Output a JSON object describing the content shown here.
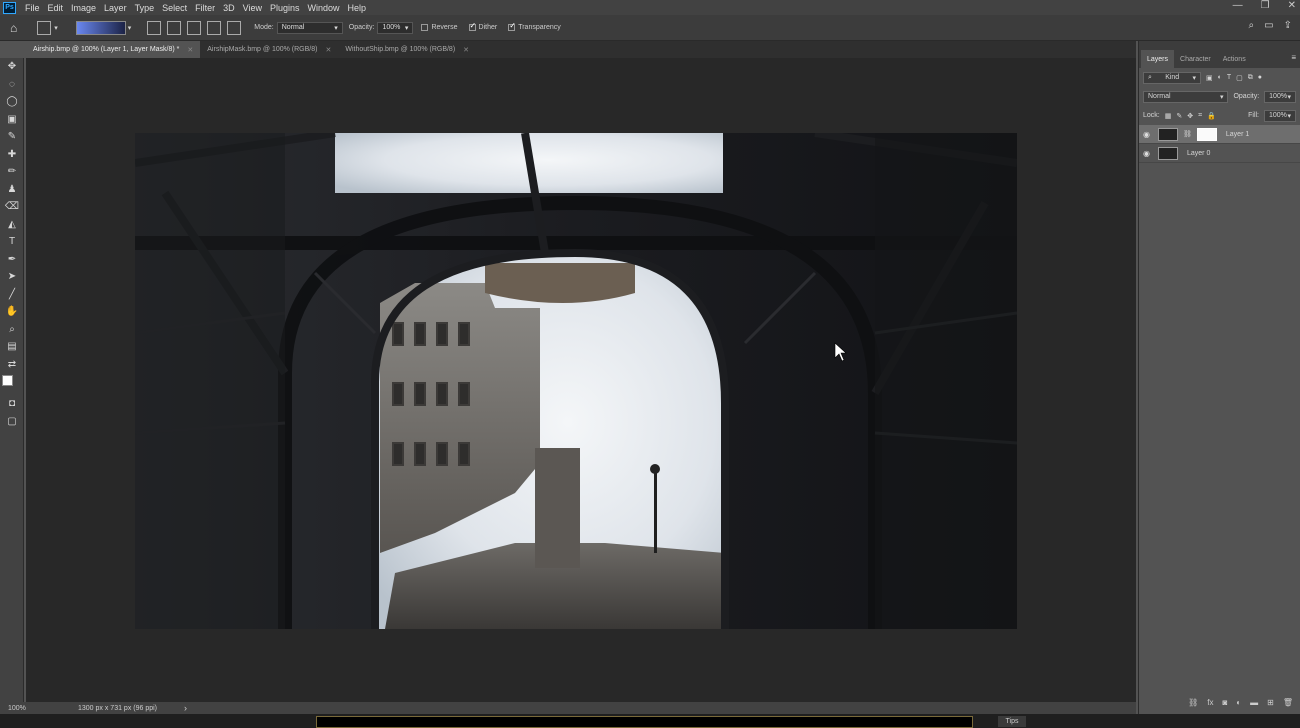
{
  "app": {
    "logo": "Ps"
  },
  "menu": [
    "File",
    "Edit",
    "Image",
    "Layer",
    "Type",
    "Select",
    "Filter",
    "3D",
    "View",
    "Plugins",
    "Window",
    "Help"
  ],
  "options": {
    "mode_label": "Mode:",
    "mode_value": "Normal",
    "opacity_label": "Opacity:",
    "opacity_value": "100%",
    "reverse_label": "Reverse",
    "dither_label": "Dither",
    "transparency_label": "Transparency",
    "reverse_checked": false,
    "dither_checked": true,
    "transparency_checked": true
  },
  "tabs": [
    {
      "label": "Airship.bmp @ 100% (Layer 1, Layer Mask/8) *",
      "active": true
    },
    {
      "label": "AirshipMask.bmp @ 100% (RGB/8)",
      "active": false
    },
    {
      "label": "WithoutShip.bmp @ 100% (RGB/8)",
      "active": false
    }
  ],
  "status": {
    "zoom": "100%",
    "doc_info": "1300 px x 731 px (96 ppi)",
    "arrow": "›"
  },
  "panel": {
    "tabs": [
      "Layers",
      "Character",
      "Actions"
    ],
    "kind_label": "Kind",
    "blend_mode": "Normal",
    "opacity_label": "Opacity:",
    "opacity_value": "100%",
    "lock_label": "Lock:",
    "fill_label": "Fill:",
    "fill_value": "100%",
    "layers": [
      {
        "name": "Layer 1",
        "has_mask": true,
        "selected": true
      },
      {
        "name": "Layer 0",
        "has_mask": false,
        "selected": false
      }
    ]
  },
  "bottom": {
    "tips": "Tips"
  },
  "colors": {
    "accent": "#31a8ff",
    "canvas_bg": "#282828",
    "ui_bg": "#535353"
  }
}
